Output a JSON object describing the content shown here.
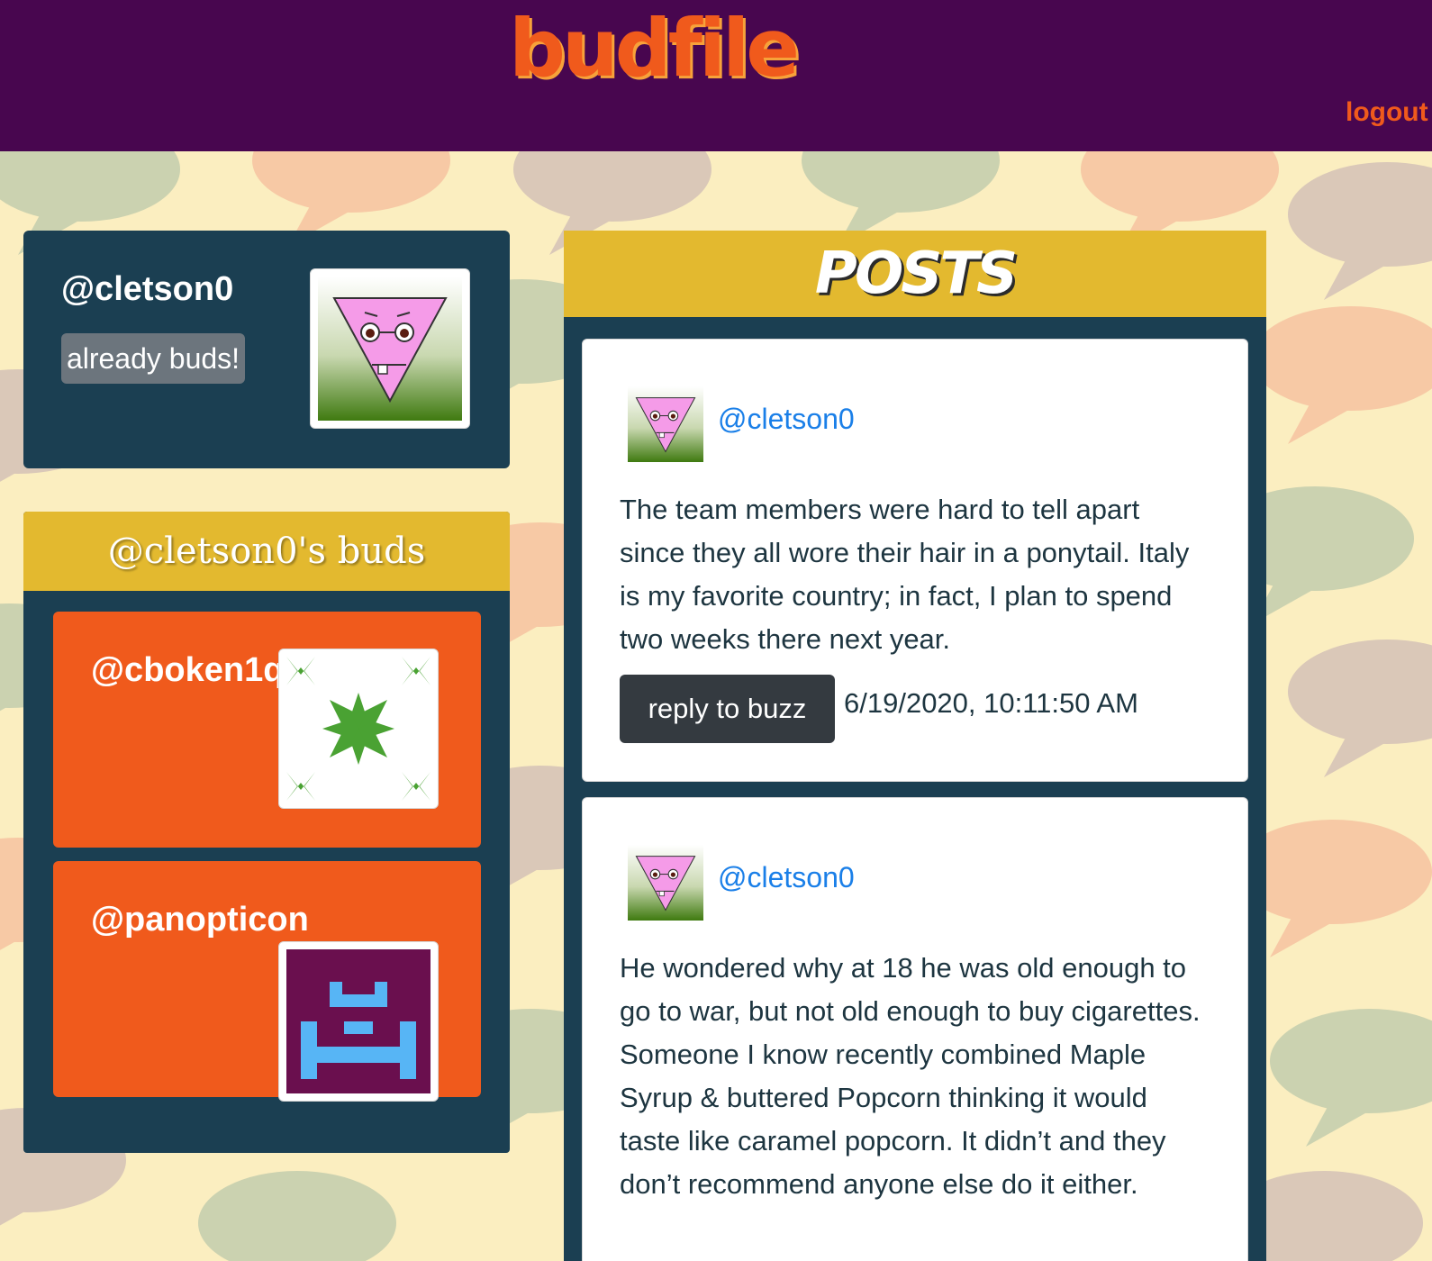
{
  "header": {
    "logo": "budfile",
    "logout_label": "logout"
  },
  "profile": {
    "handle": "@cletson0",
    "badge": "already buds!",
    "avatar_icon": "pink-triangle-face-avatar"
  },
  "buds": {
    "title": "@cletson0's buds",
    "items": [
      {
        "handle": "@cboken1q",
        "avatar_icon": "green-star-pattern-avatar"
      },
      {
        "handle": "@panopticon",
        "avatar_icon": "blue-pixel-robot-avatar"
      }
    ]
  },
  "posts": {
    "title": "POSTS",
    "items": [
      {
        "author": "@cletson0",
        "text": "The team members were hard to tell apart since they all wore their hair in a ponytail. Italy is my favorite country; in fact, I plan to spend two weeks there next year.",
        "reply_label": "reply to buzz",
        "timestamp": "6/19/2020, 10:11:50 AM"
      },
      {
        "author": "@cletson0",
        "text": "He wondered why at 18 he was old enough to go to war, but not old enough to buy cigarettes. Someone I know recently combined Maple Syrup & buttered Popcorn thinking it would taste like caramel popcorn. It didn’t and they don’t recommend anyone else do it either."
      }
    ]
  },
  "colors": {
    "topbar": "#48064f",
    "accent_orange": "#f05a1c",
    "panel_navy": "#1b3f52",
    "header_gold": "#e3b92f",
    "link_blue": "#1a7fe8"
  }
}
